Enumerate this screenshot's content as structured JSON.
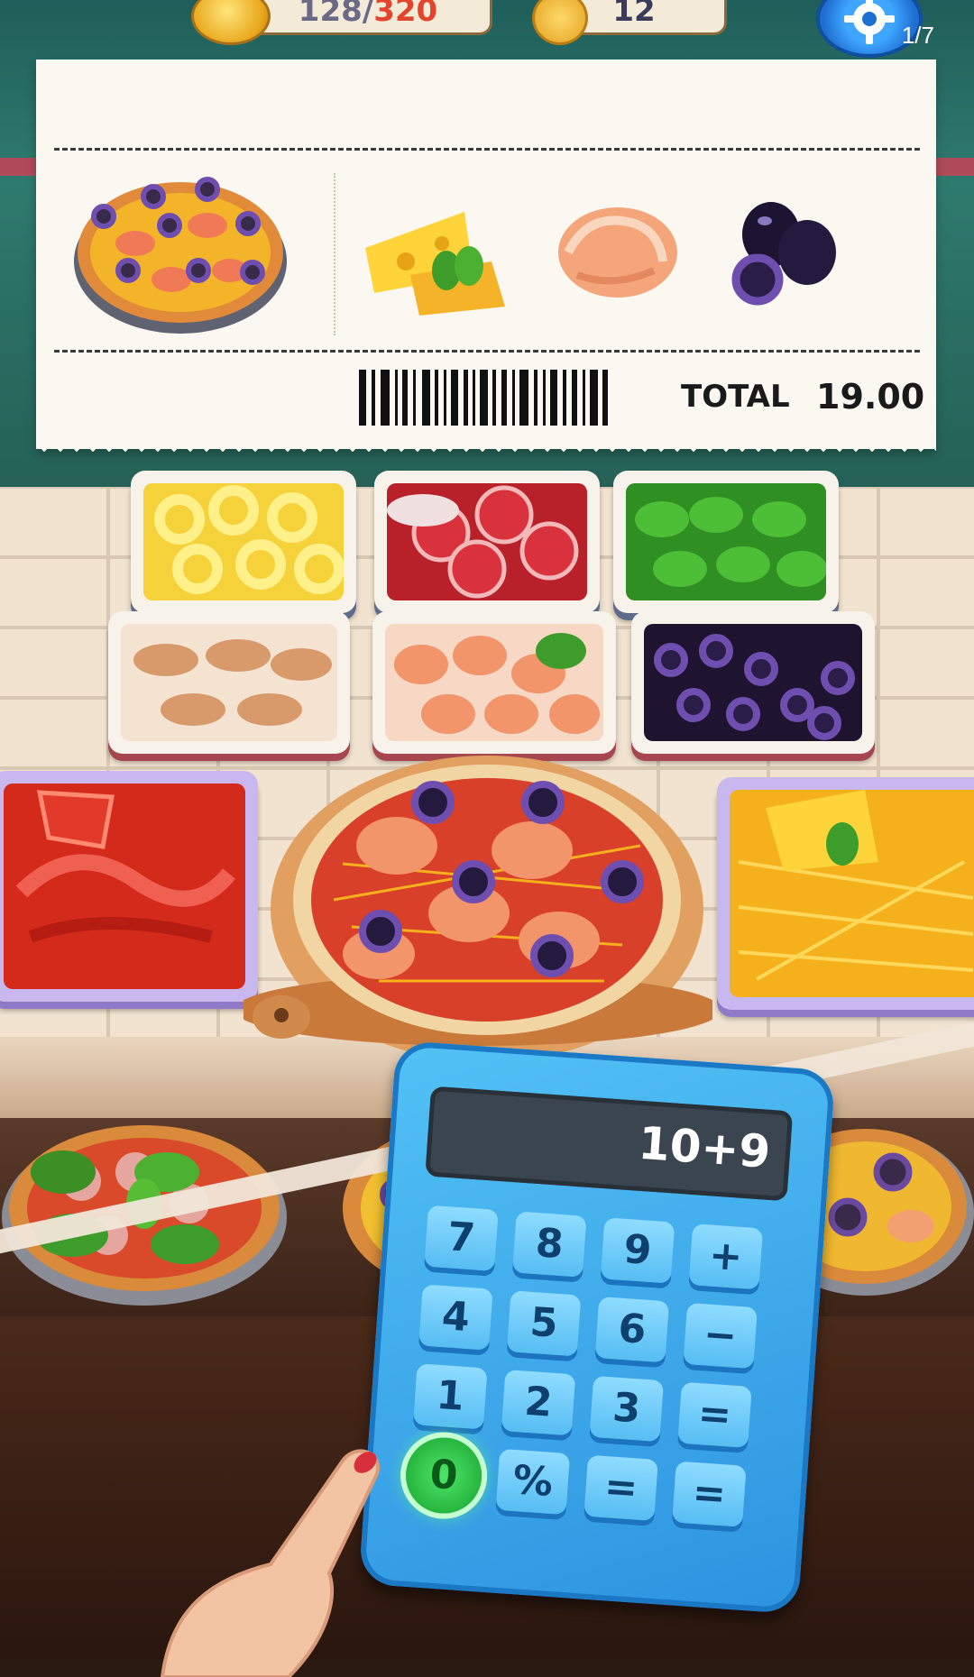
{
  "hud": {
    "coins": {
      "current": "128",
      "separator": "/",
      "max": "320",
      "icon": "coin-icon"
    },
    "level": {
      "value": "12",
      "icon": "medal-icon"
    },
    "settings_icon": "gear-icon"
  },
  "page_indicator": "1/7",
  "receipt": {
    "order_items": [
      "shrimp-olive-pizza",
      "cheese",
      "shrimp",
      "black-olives"
    ],
    "total_label": "TOTAL",
    "total_value": "19.00"
  },
  "ingredient_trays": [
    "pineapple",
    "salami",
    "basil",
    "mushrooms",
    "shrimp",
    "black-olives",
    "tomato-sauce",
    "shredded-cheese"
  ],
  "calculator": {
    "display": "10+9",
    "keys": [
      [
        "7",
        "8",
        "9",
        "+"
      ],
      [
        "4",
        "5",
        "6",
        "−"
      ],
      [
        "1",
        "2",
        "3",
        "="
      ],
      [
        "0",
        "%",
        "=",
        "="
      ]
    ],
    "active_key": "0"
  },
  "colors": {
    "calculator_body": "#3aa7ec",
    "active_key": "#22c03a",
    "total_text": "#1a1a1a",
    "coin_max": "#e2442e"
  }
}
